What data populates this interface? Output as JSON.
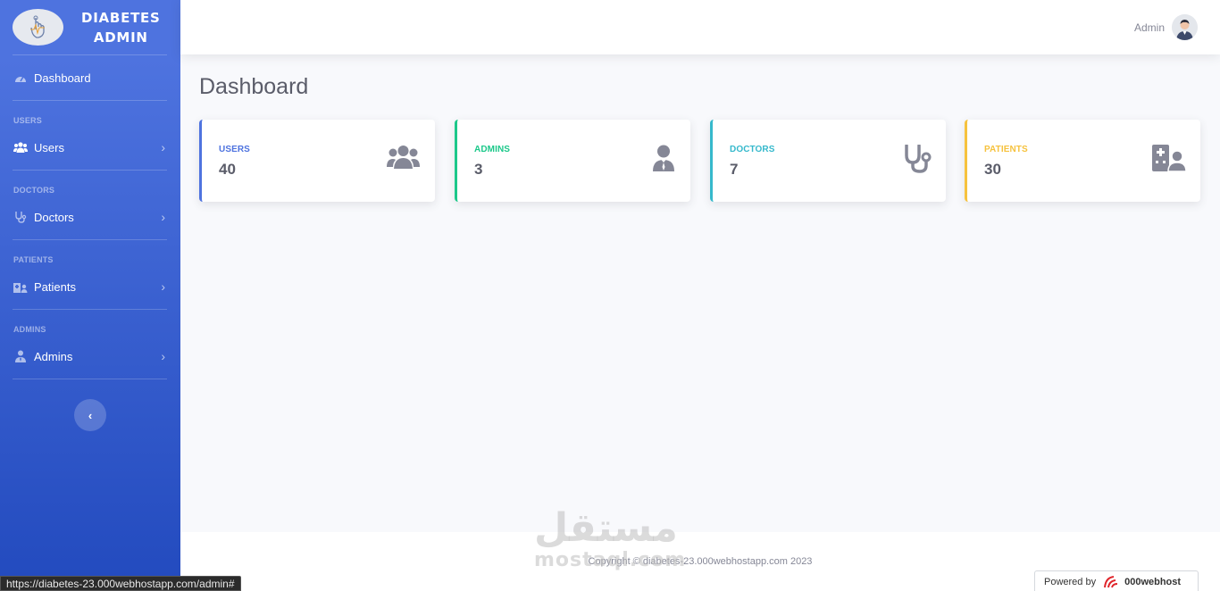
{
  "brand": {
    "line1": "DIABETES",
    "line2": "ADMIN",
    "logo_icon": "hand-touch-icon"
  },
  "sidebar": {
    "dashboard": {
      "label": "Dashboard",
      "icon": "tachometer-icon"
    },
    "sections": [
      {
        "heading": "USERS",
        "label": "Users",
        "icon": "users-icon"
      },
      {
        "heading": "DOCTORS",
        "label": "Doctors",
        "icon": "stethoscope-icon"
      },
      {
        "heading": "PATIENTS",
        "label": "Patients",
        "icon": "clinic-user-icon"
      },
      {
        "heading": "ADMINS",
        "label": "Admins",
        "icon": "user-tie-icon"
      }
    ],
    "toggle_icon": "chevron-left-icon"
  },
  "topbar": {
    "user_name": "Admin"
  },
  "page": {
    "title": "Dashboard"
  },
  "cards": [
    {
      "label": "USERS",
      "value": "40",
      "color": "#4e73df",
      "icon": "users-icon"
    },
    {
      "label": "ADMINS",
      "value": "3",
      "color": "#1cc88a",
      "icon": "user-tie-icon"
    },
    {
      "label": "DOCTORS",
      "value": "7",
      "color": "#36b9cc",
      "icon": "stethoscope-icon"
    },
    {
      "label": "PATIENTS",
      "value": "30",
      "color": "#f6c23e",
      "icon": "clinic-user-icon"
    }
  ],
  "footer": {
    "copyright": "Copyright © diabetes-23.000webhostapp.com 2023"
  },
  "watermark": {
    "arabic": "مستقل",
    "latin": "mostaql.com"
  },
  "powered": {
    "prefix": "Powered by",
    "brand": "000webhost"
  },
  "statusbar": {
    "url": "https://diabetes-23.000webhostapp.com/admin#"
  }
}
